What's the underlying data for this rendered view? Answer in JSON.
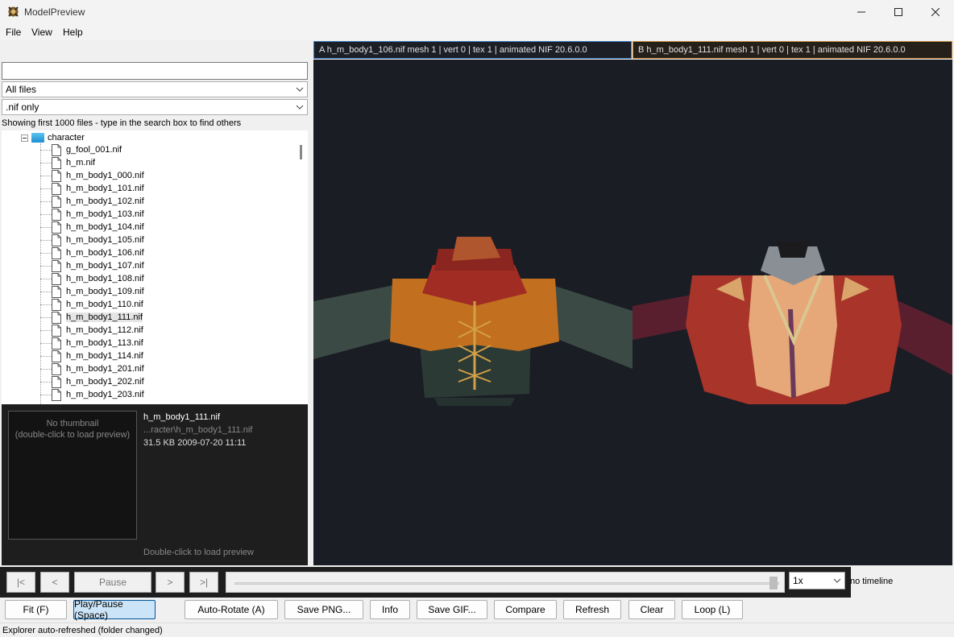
{
  "window": {
    "title": "ModelPreview"
  },
  "menu": [
    "File",
    "View",
    "Help"
  ],
  "explorer": {
    "search_value": "",
    "file_filter": "All files",
    "ext_filter": ".nif only",
    "hint": "Showing first 1000 files - type in the search box to find others",
    "folder": "character",
    "files": [
      "g_fool_001.nif",
      "h_m.nif",
      "h_m_body1_000.nif",
      "h_m_body1_101.nif",
      "h_m_body1_102.nif",
      "h_m_body1_103.nif",
      "h_m_body1_104.nif",
      "h_m_body1_105.nif",
      "h_m_body1_106.nif",
      "h_m_body1_107.nif",
      "h_m_body1_108.nif",
      "h_m_body1_109.nif",
      "h_m_body1_110.nif",
      "h_m_body1_111.nif",
      "h_m_body1_112.nif",
      "h_m_body1_113.nif",
      "h_m_body1_114.nif",
      "h_m_body1_201.nif",
      "h_m_body1_202.nif",
      "h_m_body1_203.nif"
    ],
    "selected_file": "h_m_body1_111.nif"
  },
  "info": {
    "thumb_line1": "No thumbnail",
    "thumb_line2": "(double-click to load preview)",
    "name": "h_m_body1_111.nif",
    "path": "...racter\\h_m_body1_111.nif",
    "meta": "31.5 KB  2009-07-20 11:11",
    "hint": "Double-click to load preview"
  },
  "viewport_a": {
    "header": "A  h_m_body1_106.nif   mesh 1 | vert 0 | tex 1 | animated   NIF 20.6.0.0"
  },
  "viewport_b": {
    "header": "B  h_m_body1_111.nif   mesh 1 | vert 0 | tex 1 | animated   NIF 20.6.0.0"
  },
  "timeline": {
    "first": "|<",
    "prev": "<",
    "pause": "Pause",
    "next": ">",
    "last": ">|",
    "position": 0.99,
    "speed": "1x",
    "status": "no timeline"
  },
  "actions": [
    {
      "id": "fit",
      "label": "Fit (F)"
    },
    {
      "id": "playpause",
      "label": "Play/Pause (Space)"
    },
    {
      "id": "autorotate",
      "label": "Auto-Rotate (A)"
    },
    {
      "id": "savepng",
      "label": "Save PNG..."
    },
    {
      "id": "info",
      "label": "Info"
    },
    {
      "id": "savegif",
      "label": "Save GIF..."
    },
    {
      "id": "compare",
      "label": "Compare"
    },
    {
      "id": "refresh",
      "label": "Refresh"
    },
    {
      "id": "clear",
      "label": "Clear"
    },
    {
      "id": "loop",
      "label": "Loop (L)"
    }
  ],
  "status": "Explorer auto-refreshed (folder changed)",
  "colors": {
    "accent_a": "#3a78c4",
    "accent_b": "#c48a3a",
    "viewport_bg": "#1a1d24"
  }
}
